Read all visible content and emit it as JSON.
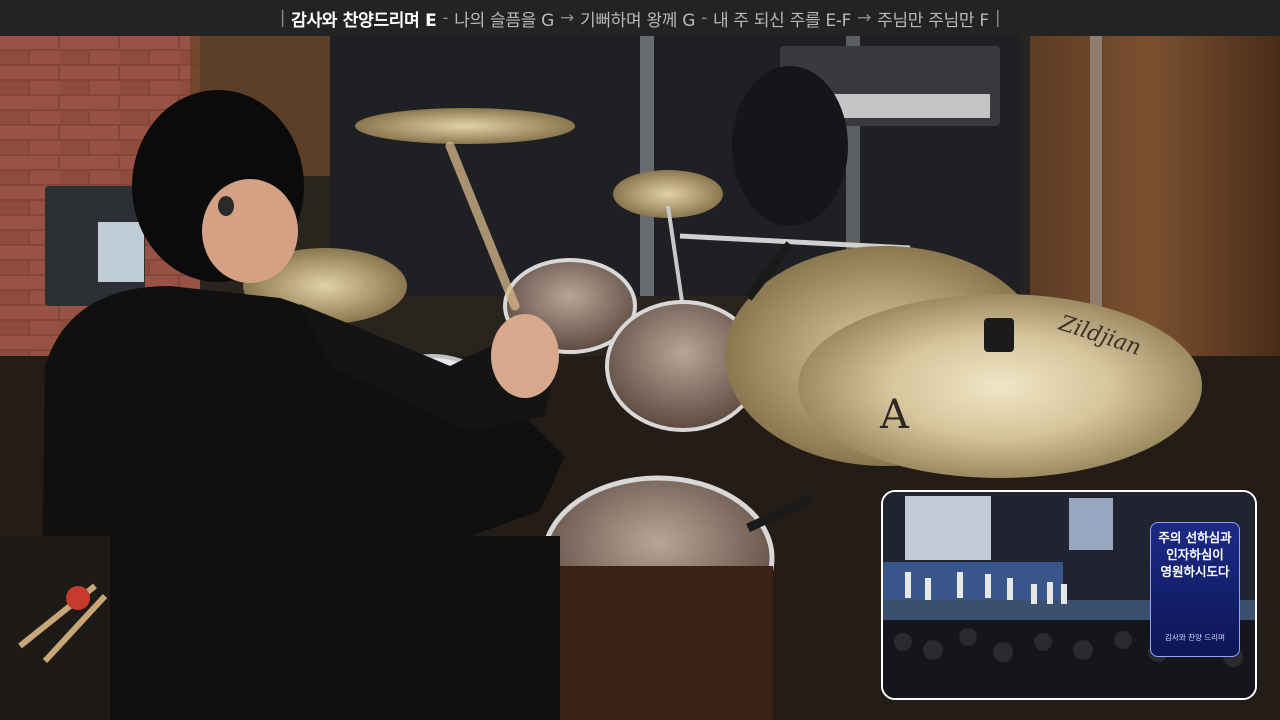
{
  "top_bar": {
    "current_song": "감사와 찬양드리며 E",
    "upcoming": [
      "나의 슬픔을 G",
      "기뻐하며 왕께 G",
      "내 주 되신 주를 E-F",
      "주님만 주님만 F"
    ]
  },
  "scene": {
    "cymbal_brand": "Zildjian",
    "cymbal_model_mark": "A"
  },
  "pip": {
    "lyrics": [
      "주의 선하심과",
      "인자하심이",
      "영원하시도다"
    ],
    "caption": "감사와 찬양 드리며"
  },
  "colors": {
    "top_bar_bg": "#232323",
    "lyric_card": "#1c2a86",
    "cymbal": "#d8c9a4"
  }
}
